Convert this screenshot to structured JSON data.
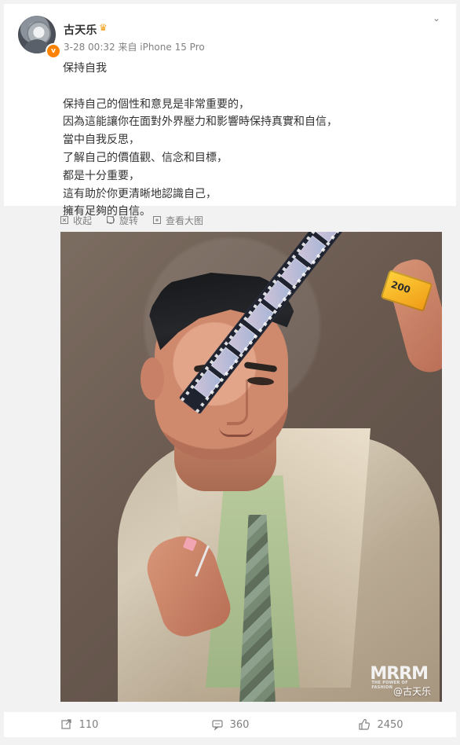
{
  "post": {
    "author": "古天乐",
    "meta": "3-28 00:32 来自 iPhone 15 Pro",
    "avatar_icon": "avatar-icon",
    "badge_icon": "verified-badge-icon",
    "crown_icon": "crown-icon",
    "menu_icon": "chevron-down-icon",
    "content": [
      "保持自我",
      "",
      "保持自己的個性和意見是非常重要的，",
      "因為這能讓你在面對外界壓力和影響時保持真實和自信，",
      "當中自我反思，",
      "了解自己的價值觀、信念和目標，",
      "都是十分重要，",
      "這有助於你更清晰地認識自己，",
      "擁有足夠的自信。"
    ]
  },
  "image_tools": [
    {
      "label": "收起",
      "icon": "collapse-icon"
    },
    {
      "label": "旋转",
      "icon": "rotate-icon"
    },
    {
      "label": "查看大图",
      "icon": "zoom-icon"
    }
  ],
  "photo": {
    "brand": "MRRM",
    "tagline": "THE POWER OF FASHION",
    "watermark": "@古天乐",
    "film_box_label": "200"
  },
  "actions": [
    {
      "label": "110",
      "icon": "repost-icon"
    },
    {
      "label": "360",
      "icon": "comment-icon"
    },
    {
      "label": "2450",
      "icon": "like-icon"
    }
  ],
  "colors": {
    "page_bg": "#f2f2f2",
    "card_bg": "#ffffff",
    "accent": "#ff8200"
  }
}
